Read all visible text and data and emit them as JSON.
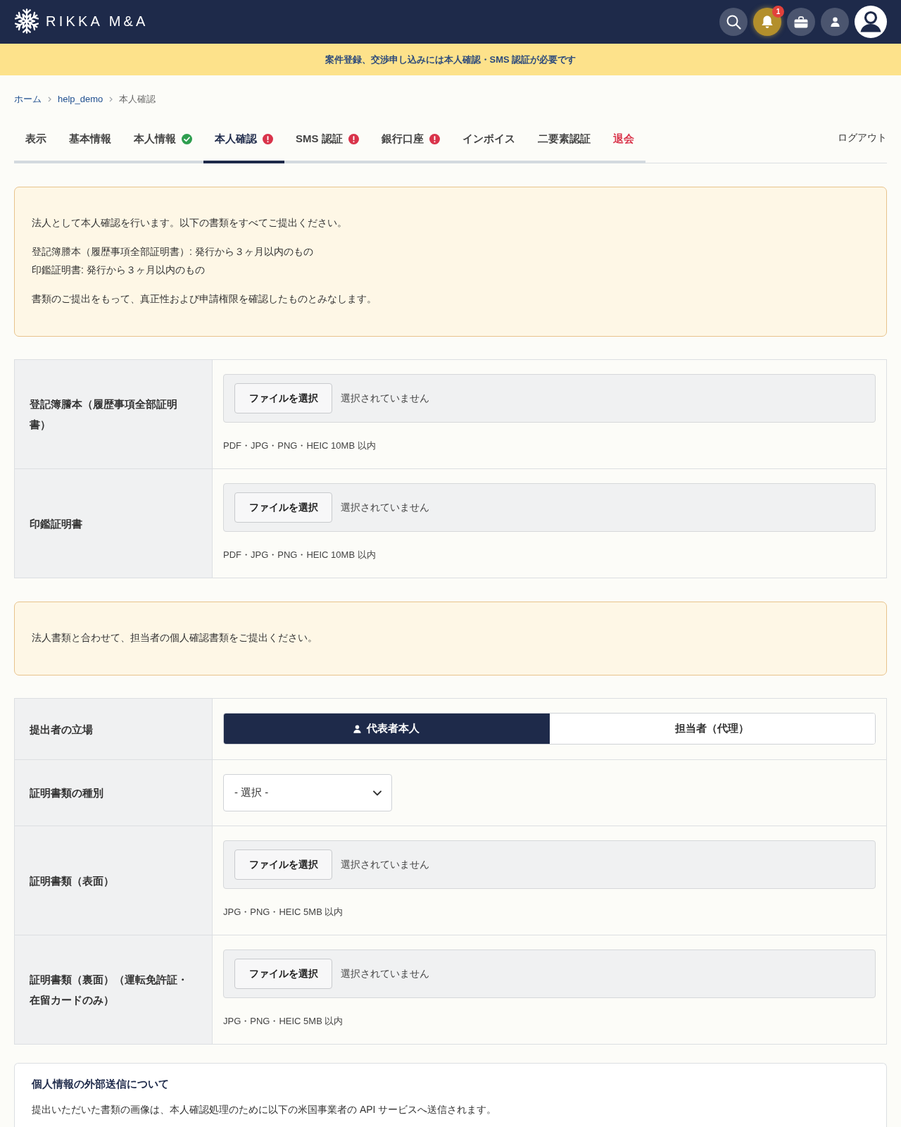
{
  "header": {
    "logo": "RIKKA M&A",
    "notification_count": "1"
  },
  "banner": "案件登録、交渉申し込みには本人確認・SMS 認証が必要です",
  "breadcrumb": [
    {
      "label": "ホーム",
      "kind": "link"
    },
    {
      "label": "help_demo",
      "kind": "link"
    },
    {
      "label": "本人確認",
      "kind": "current"
    }
  ],
  "tabs": [
    {
      "label": "表示",
      "selected": false,
      "verified": false,
      "needs_action": false,
      "kind": "normal"
    },
    {
      "label": "基本情報",
      "selected": false,
      "verified": false,
      "needs_action": false,
      "kind": "normal"
    },
    {
      "label": "本人情報",
      "selected": false,
      "verified": true,
      "needs_action": false,
      "kind": "normal"
    },
    {
      "label": "本人確認",
      "selected": true,
      "verified": false,
      "needs_action": true,
      "kind": "normal"
    },
    {
      "label": "SMS 認証",
      "selected": false,
      "verified": false,
      "needs_action": true,
      "kind": "normal"
    },
    {
      "label": "銀行口座",
      "selected": false,
      "verified": false,
      "needs_action": true,
      "kind": "normal"
    },
    {
      "label": "インボイス",
      "selected": false,
      "verified": false,
      "needs_action": false,
      "kind": "normal"
    },
    {
      "label": "二要素認証",
      "selected": false,
      "verified": false,
      "needs_action": false,
      "kind": "normal"
    },
    {
      "label": "退会",
      "selected": false,
      "verified": false,
      "needs_action": false,
      "kind": "danger"
    }
  ],
  "logout": "ログアウト",
  "corporate_notice": {
    "paragraphs": [
      [
        "法人として本人確認を行います。以下の書類をすべてご提出ください。"
      ],
      [
        "登記簿謄本（履歴事項全部証明書）: 発行から３ヶ月以内のもの",
        "印鑑証明書: 発行から３ヶ月以内のもの"
      ],
      [
        "書類のご提出をもって、真正性および申請権限を確認したものとみなします。"
      ]
    ]
  },
  "corporate_documents": [
    {
      "kind": "file",
      "label": "登記簿謄本（履歴事項全部証明書）",
      "button": "ファイルを選択",
      "status": "選択されていません",
      "hint": "PDF・JPG・PNG・HEIC 10MB 以内"
    },
    {
      "kind": "file",
      "label": "印鑑証明書",
      "button": "ファイルを選択",
      "status": "選択されていません",
      "hint": "PDF・JPG・PNG・HEIC 10MB 以内"
    }
  ],
  "personal_notice": {
    "paragraphs": [
      [
        "法人書類と合わせて、担当者の個人確認書類をご提出ください。"
      ]
    ]
  },
  "personal_documents": [
    {
      "kind": "toggle",
      "label": "提出者の立場",
      "options": [
        {
          "label": "代表者本人",
          "selected": true
        },
        {
          "label": "担当者（代理）",
          "selected": false
        }
      ]
    },
    {
      "kind": "select",
      "label": "証明書類の種別",
      "value": "- 選択 -"
    },
    {
      "kind": "file",
      "label": "証明書類（表面）",
      "button": "ファイルを選択",
      "status": "選択されていません",
      "hint": "JPG・PNG・HEIC 5MB 以内"
    },
    {
      "kind": "file",
      "label": "証明書類（裏面）（運転免許証・在留カードのみ）",
      "button": "ファイルを選択",
      "status": "選択されていません",
      "hint": "JPG・PNG・HEIC 5MB 以内"
    }
  ],
  "external_transfer": {
    "title": "個人情報の外部送信について",
    "text": "提出いただいた書類の画像は、本人確認処理のために以下の米国事業者の API サービスへ送信されます。"
  }
}
